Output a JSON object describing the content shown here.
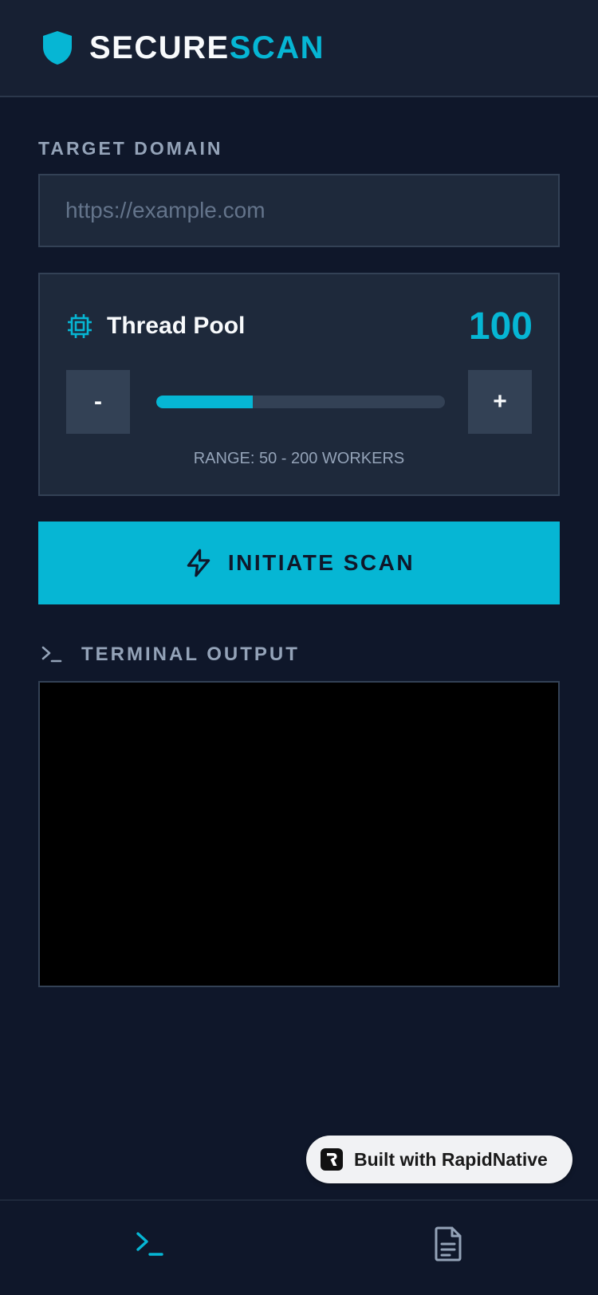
{
  "header": {
    "brand_part1": "SECURE",
    "brand_part2": "SCAN",
    "brand_icon": "shield-icon"
  },
  "target": {
    "label": "TARGET DOMAIN",
    "value": "",
    "placeholder": "https://example.com"
  },
  "thread_pool": {
    "icon": "cpu-chip-icon",
    "title": "Thread Pool",
    "value": "100",
    "min": 50,
    "max": 200,
    "level_fraction": 0.333,
    "decrement_label": "-",
    "increment_label": "+",
    "range_text": "RANGE: 50 - 200 WORKERS"
  },
  "scan_button": {
    "icon": "lightning-bolt-icon",
    "label": "INITIATE SCAN"
  },
  "terminal": {
    "icon": "terminal-prompt-icon",
    "label": "TERMINAL OUTPUT",
    "lines": []
  },
  "badge": {
    "text": "Built with RapidNative"
  },
  "bottom_nav": {
    "items": [
      {
        "icon": "terminal-prompt-icon",
        "active": true
      },
      {
        "icon": "document-icon",
        "active": false
      }
    ]
  },
  "colors": {
    "background": "#0f172a",
    "surface": "#1e293b",
    "accent": "#06b6d4",
    "muted_text": "#94a3b8"
  }
}
